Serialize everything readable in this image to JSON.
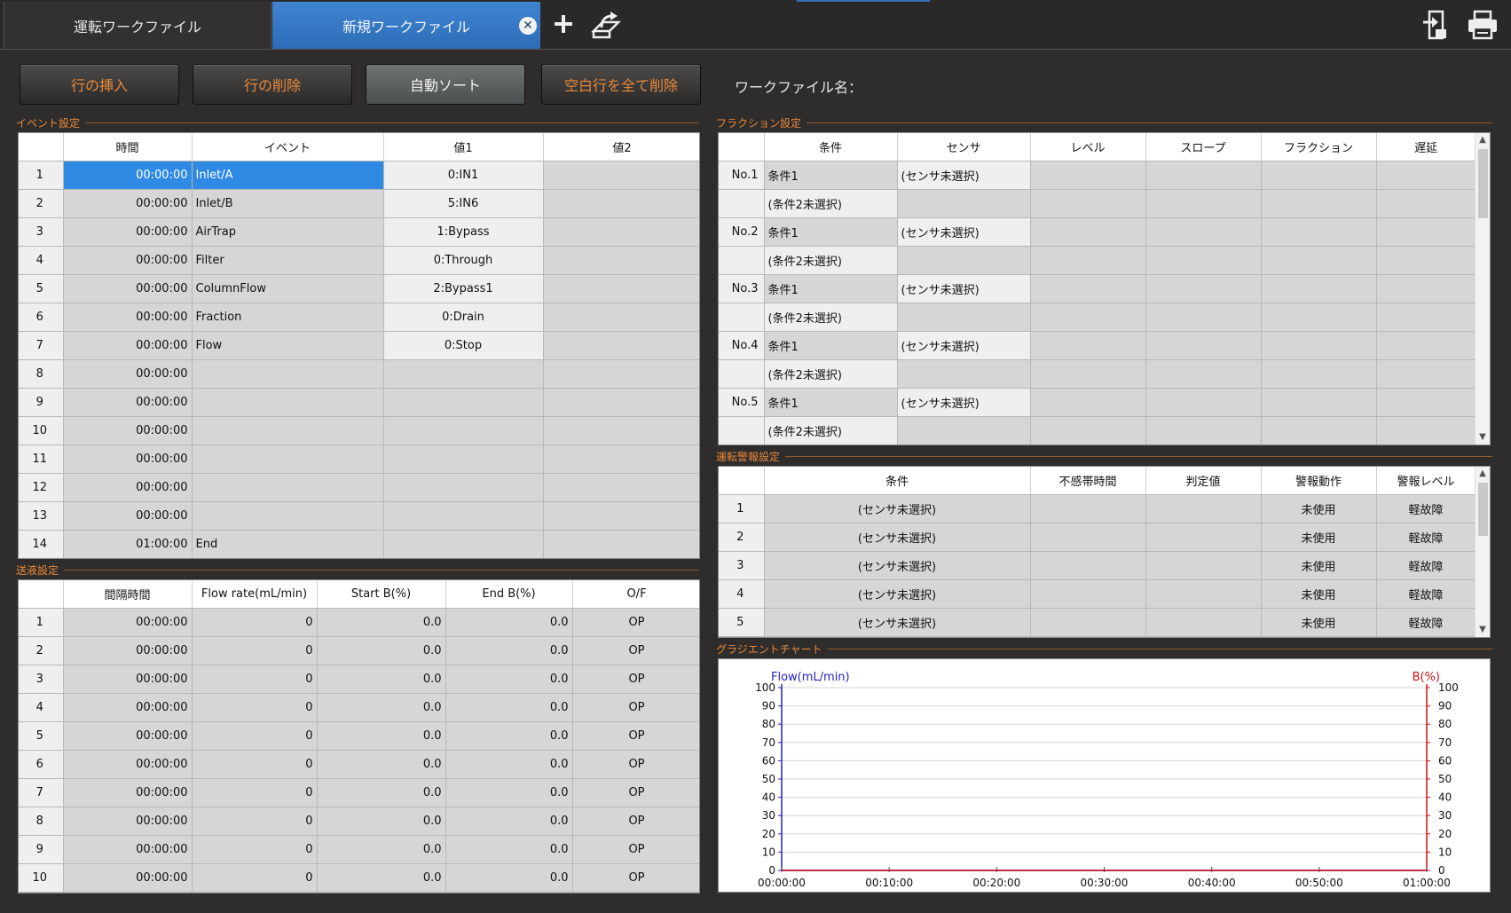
{
  "tabs": [
    {
      "label": "運転ワークファイル"
    },
    {
      "label": "新規ワークファイル"
    }
  ],
  "icons": {
    "close": "close-icon",
    "add": "plus-icon",
    "export": "export-icon",
    "save": "save-icon",
    "print": "printer-icon"
  },
  "colors": {
    "accent_orange": "#e8883a",
    "selected_tab": "#2d6db8",
    "selected_cell": "#2f8ae3",
    "flow_axis": "#2222cc",
    "b_axis": "#d01010"
  },
  "toolbar": {
    "insert_row": "行の挿入",
    "delete_row": "行の削除",
    "auto_sort": "自動ソート",
    "delete_empty_rows": "空白行を全て削除",
    "workfile_name_label": "ワークファイル名："
  },
  "event": {
    "title": "イベント設定",
    "headers": [
      "",
      "時間",
      "イベント",
      "値1",
      "値2"
    ],
    "rows": [
      [
        "1",
        "00:00:00",
        "Inlet/A",
        "0:IN1",
        ""
      ],
      [
        "2",
        "00:00:00",
        "Inlet/B",
        "5:IN6",
        ""
      ],
      [
        "3",
        "00:00:00",
        "AirTrap",
        "1:Bypass",
        ""
      ],
      [
        "4",
        "00:00:00",
        "Filter",
        "0:Through",
        ""
      ],
      [
        "5",
        "00:00:00",
        "ColumnFlow",
        "2:Bypass1",
        ""
      ],
      [
        "6",
        "00:00:00",
        "Fraction",
        "0:Drain",
        ""
      ],
      [
        "7",
        "00:00:00",
        "Flow",
        "0:Stop",
        ""
      ],
      [
        "8",
        "00:00:00",
        "",
        "",
        ""
      ],
      [
        "9",
        "00:00:00",
        "",
        "",
        ""
      ],
      [
        "10",
        "00:00:00",
        "",
        "",
        ""
      ],
      [
        "11",
        "00:00:00",
        "",
        "",
        ""
      ],
      [
        "12",
        "00:00:00",
        "",
        "",
        ""
      ],
      [
        "13",
        "00:00:00",
        "",
        "",
        ""
      ],
      [
        "14",
        "01:00:00",
        "End",
        "",
        ""
      ]
    ]
  },
  "pump": {
    "title": "送液設定",
    "headers": [
      "",
      "間隔時間",
      "Flow rate(mL/min)",
      "Start B(%)",
      "End B(%)",
      "O/F"
    ],
    "rows": [
      [
        "1",
        "00:00:00",
        "0",
        "0.0",
        "0.0",
        "OP"
      ],
      [
        "2",
        "00:00:00",
        "0",
        "0.0",
        "0.0",
        "OP"
      ],
      [
        "3",
        "00:00:00",
        "0",
        "0.0",
        "0.0",
        "OP"
      ],
      [
        "4",
        "00:00:00",
        "0",
        "0.0",
        "0.0",
        "OP"
      ],
      [
        "5",
        "00:00:00",
        "0",
        "0.0",
        "0.0",
        "OP"
      ],
      [
        "6",
        "00:00:00",
        "0",
        "0.0",
        "0.0",
        "OP"
      ],
      [
        "7",
        "00:00:00",
        "0",
        "0.0",
        "0.0",
        "OP"
      ],
      [
        "8",
        "00:00:00",
        "0",
        "0.0",
        "0.0",
        "OP"
      ],
      [
        "9",
        "00:00:00",
        "0",
        "0.0",
        "0.0",
        "OP"
      ],
      [
        "10",
        "00:00:00",
        "0",
        "0.0",
        "0.0",
        "OP"
      ]
    ]
  },
  "fraction": {
    "title": "フラクション設定",
    "headers": [
      "",
      "条件",
      "センサ",
      "レベル",
      "スロープ",
      "フラクション",
      "遅延"
    ],
    "rows": [
      [
        "No.1",
        "条件1",
        "(センサ未選択)",
        "",
        "",
        "",
        ""
      ],
      [
        "",
        "(条件2未選択)",
        "",
        "",
        "",
        "",
        ""
      ],
      [
        "No.2",
        "条件1",
        "(センサ未選択)",
        "",
        "",
        "",
        ""
      ],
      [
        "",
        "(条件2未選択)",
        "",
        "",
        "",
        "",
        ""
      ],
      [
        "No.3",
        "条件1",
        "(センサ未選択)",
        "",
        "",
        "",
        ""
      ],
      [
        "",
        "(条件2未選択)",
        "",
        "",
        "",
        "",
        ""
      ],
      [
        "No.4",
        "条件1",
        "(センサ未選択)",
        "",
        "",
        "",
        ""
      ],
      [
        "",
        "(条件2未選択)",
        "",
        "",
        "",
        "",
        ""
      ],
      [
        "No.5",
        "条件1",
        "(センサ未選択)",
        "",
        "",
        "",
        ""
      ],
      [
        "",
        "(条件2未選択)",
        "",
        "",
        "",
        "",
        ""
      ]
    ]
  },
  "alarm": {
    "title": "運転警報設定",
    "headers": [
      "",
      "条件",
      "不感帯時間",
      "判定値",
      "警報動作",
      "警報レベル"
    ],
    "rows": [
      [
        "1",
        "(センサ未選択)",
        "",
        "",
        "未使用",
        "軽故障"
      ],
      [
        "2",
        "(センサ未選択)",
        "",
        "",
        "未使用",
        "軽故障"
      ],
      [
        "3",
        "(センサ未選択)",
        "",
        "",
        "未使用",
        "軽故障"
      ],
      [
        "4",
        "(センサ未選択)",
        "",
        "",
        "未使用",
        "軽故障"
      ],
      [
        "5",
        "(センサ未選択)",
        "",
        "",
        "未使用",
        "軽故障"
      ]
    ]
  },
  "gradient": {
    "title": "グラジエントチャート"
  },
  "chart_data": {
    "type": "line",
    "left_axis_label": "Flow(mL/min)",
    "right_axis_label": "B(%)",
    "x_ticks": [
      "00:00:00",
      "00:10:00",
      "00:20:00",
      "00:30:00",
      "00:40:00",
      "00:50:00",
      "01:00:00"
    ],
    "xlim_minutes": [
      0,
      60
    ],
    "y_ticks": [
      0,
      10,
      20,
      30,
      40,
      50,
      60,
      70,
      80,
      90,
      100
    ],
    "ylim": [
      0,
      100
    ],
    "grid": true,
    "series": [
      {
        "axis": "left",
        "color": "#2222cc",
        "x_minutes": [
          0,
          60
        ],
        "values": [
          0,
          0
        ]
      },
      {
        "axis": "right",
        "color": "#d01010",
        "x_minutes": [
          0,
          60
        ],
        "values": [
          0,
          0
        ]
      }
    ]
  }
}
